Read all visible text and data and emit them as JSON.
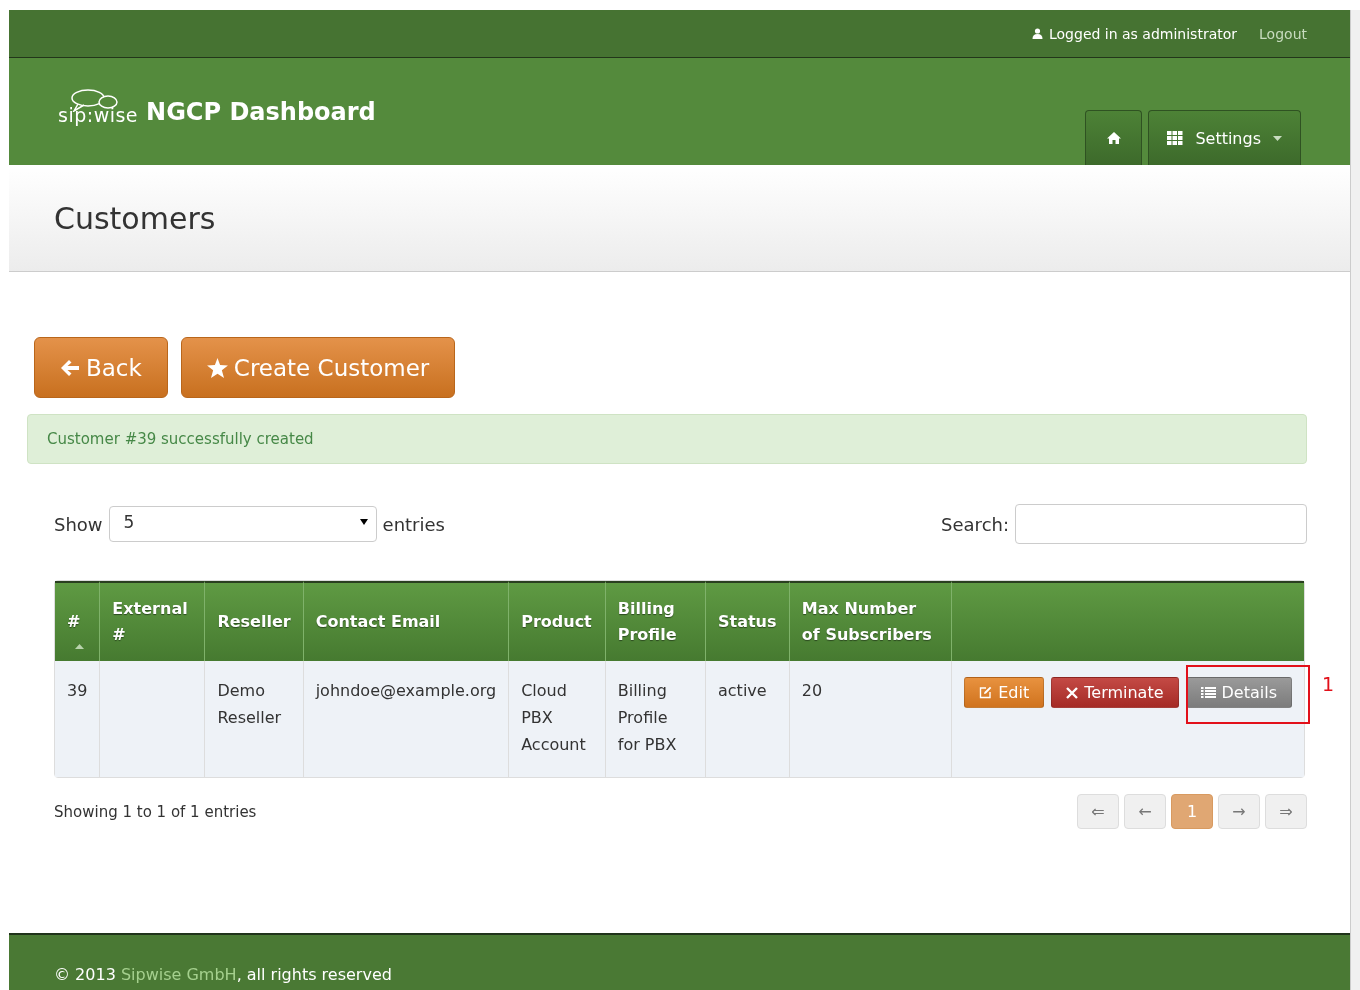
{
  "topbar": {
    "user": "Logged in as administrator",
    "logout": "Logout"
  },
  "brand": {
    "logo": "sip:wise",
    "title": "NGCP Dashboard"
  },
  "nav": {
    "settings": "Settings"
  },
  "page_title": "Customers",
  "actions": [
    {
      "kind": "back",
      "label": "Back"
    },
    {
      "kind": "create",
      "label": "Create Customer"
    }
  ],
  "alert": "Customer #39 successfully created",
  "length": {
    "show": "Show",
    "value": "5",
    "entries": "entries"
  },
  "search": {
    "label": "Search:"
  },
  "table": {
    "columns": [
      {
        "label": "#",
        "sorted": true
      },
      {
        "label": "External #",
        "sorted": false
      },
      {
        "label": "Reseller",
        "sorted": false
      },
      {
        "label": "Contact Email",
        "sorted": false
      },
      {
        "label": "Product",
        "sorted": false
      },
      {
        "label": "Billing Profile",
        "sorted": false
      },
      {
        "label": "Status",
        "sorted": false
      },
      {
        "label": "Max Number of Subscribers",
        "sorted": false
      }
    ],
    "rows": [
      {
        "cells": [
          "39",
          "",
          "Demo Reseller",
          "johndoe@example.org",
          "Cloud PBX Account",
          "Billing Profile for PBX",
          "active",
          "20"
        ],
        "buttons": [
          {
            "kind": "edit",
            "label": "Edit"
          },
          {
            "kind": "terminate",
            "label": "Terminate"
          },
          {
            "kind": "details",
            "label": "Details"
          }
        ]
      }
    ]
  },
  "callout": {
    "label": "1"
  },
  "info": "Showing 1 to 1 of 1 entries",
  "pagination": [
    {
      "label": "⇐",
      "selected": false
    },
    {
      "label": "←",
      "selected": false
    },
    {
      "label": "1",
      "selected": true
    },
    {
      "label": "→",
      "selected": false
    },
    {
      "label": "⇒",
      "selected": false
    }
  ],
  "footer": {
    "prefix": "© 2013",
    "link": "Sipwise GmbH",
    "suffix": ", all rights reserved"
  }
}
